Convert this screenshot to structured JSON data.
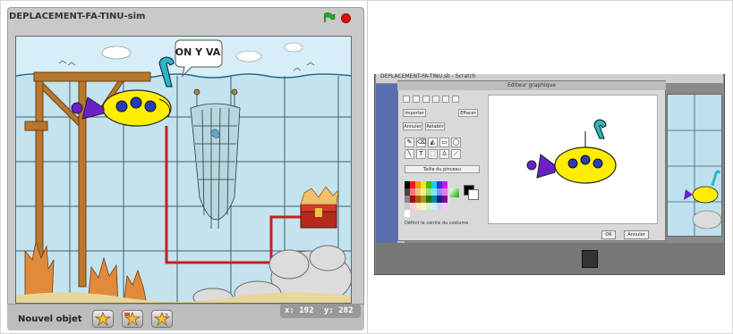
{
  "left": {
    "stage_title": "DEPLACEMENT-FA-TINU-sim",
    "speech_bubble": "ON Y VA",
    "new_object_label": "Nouvel objet",
    "x_coord": "x: 192",
    "y_coord": "y: 282"
  },
  "right": {
    "window_title": "DEPLACEMENT-FA-TINU.sb - Scratch",
    "dialog_title": "Editeur graphique",
    "import_label": "Importer",
    "clear_label": "Effacer",
    "undo_label": "Annuler",
    "redo_label": "Rétablir",
    "brush_size_label": "Taille du pinceau",
    "set_center_label": "Définir le centre du costume",
    "ok_label": "OK",
    "cancel_label": "Annuler"
  },
  "colors": {
    "flag": "#1fae1f",
    "stop": "#d81010",
    "sub_body": "#ffee00",
    "sub_tail": "#6b1fc9",
    "periscope": "#2bb7c0"
  }
}
